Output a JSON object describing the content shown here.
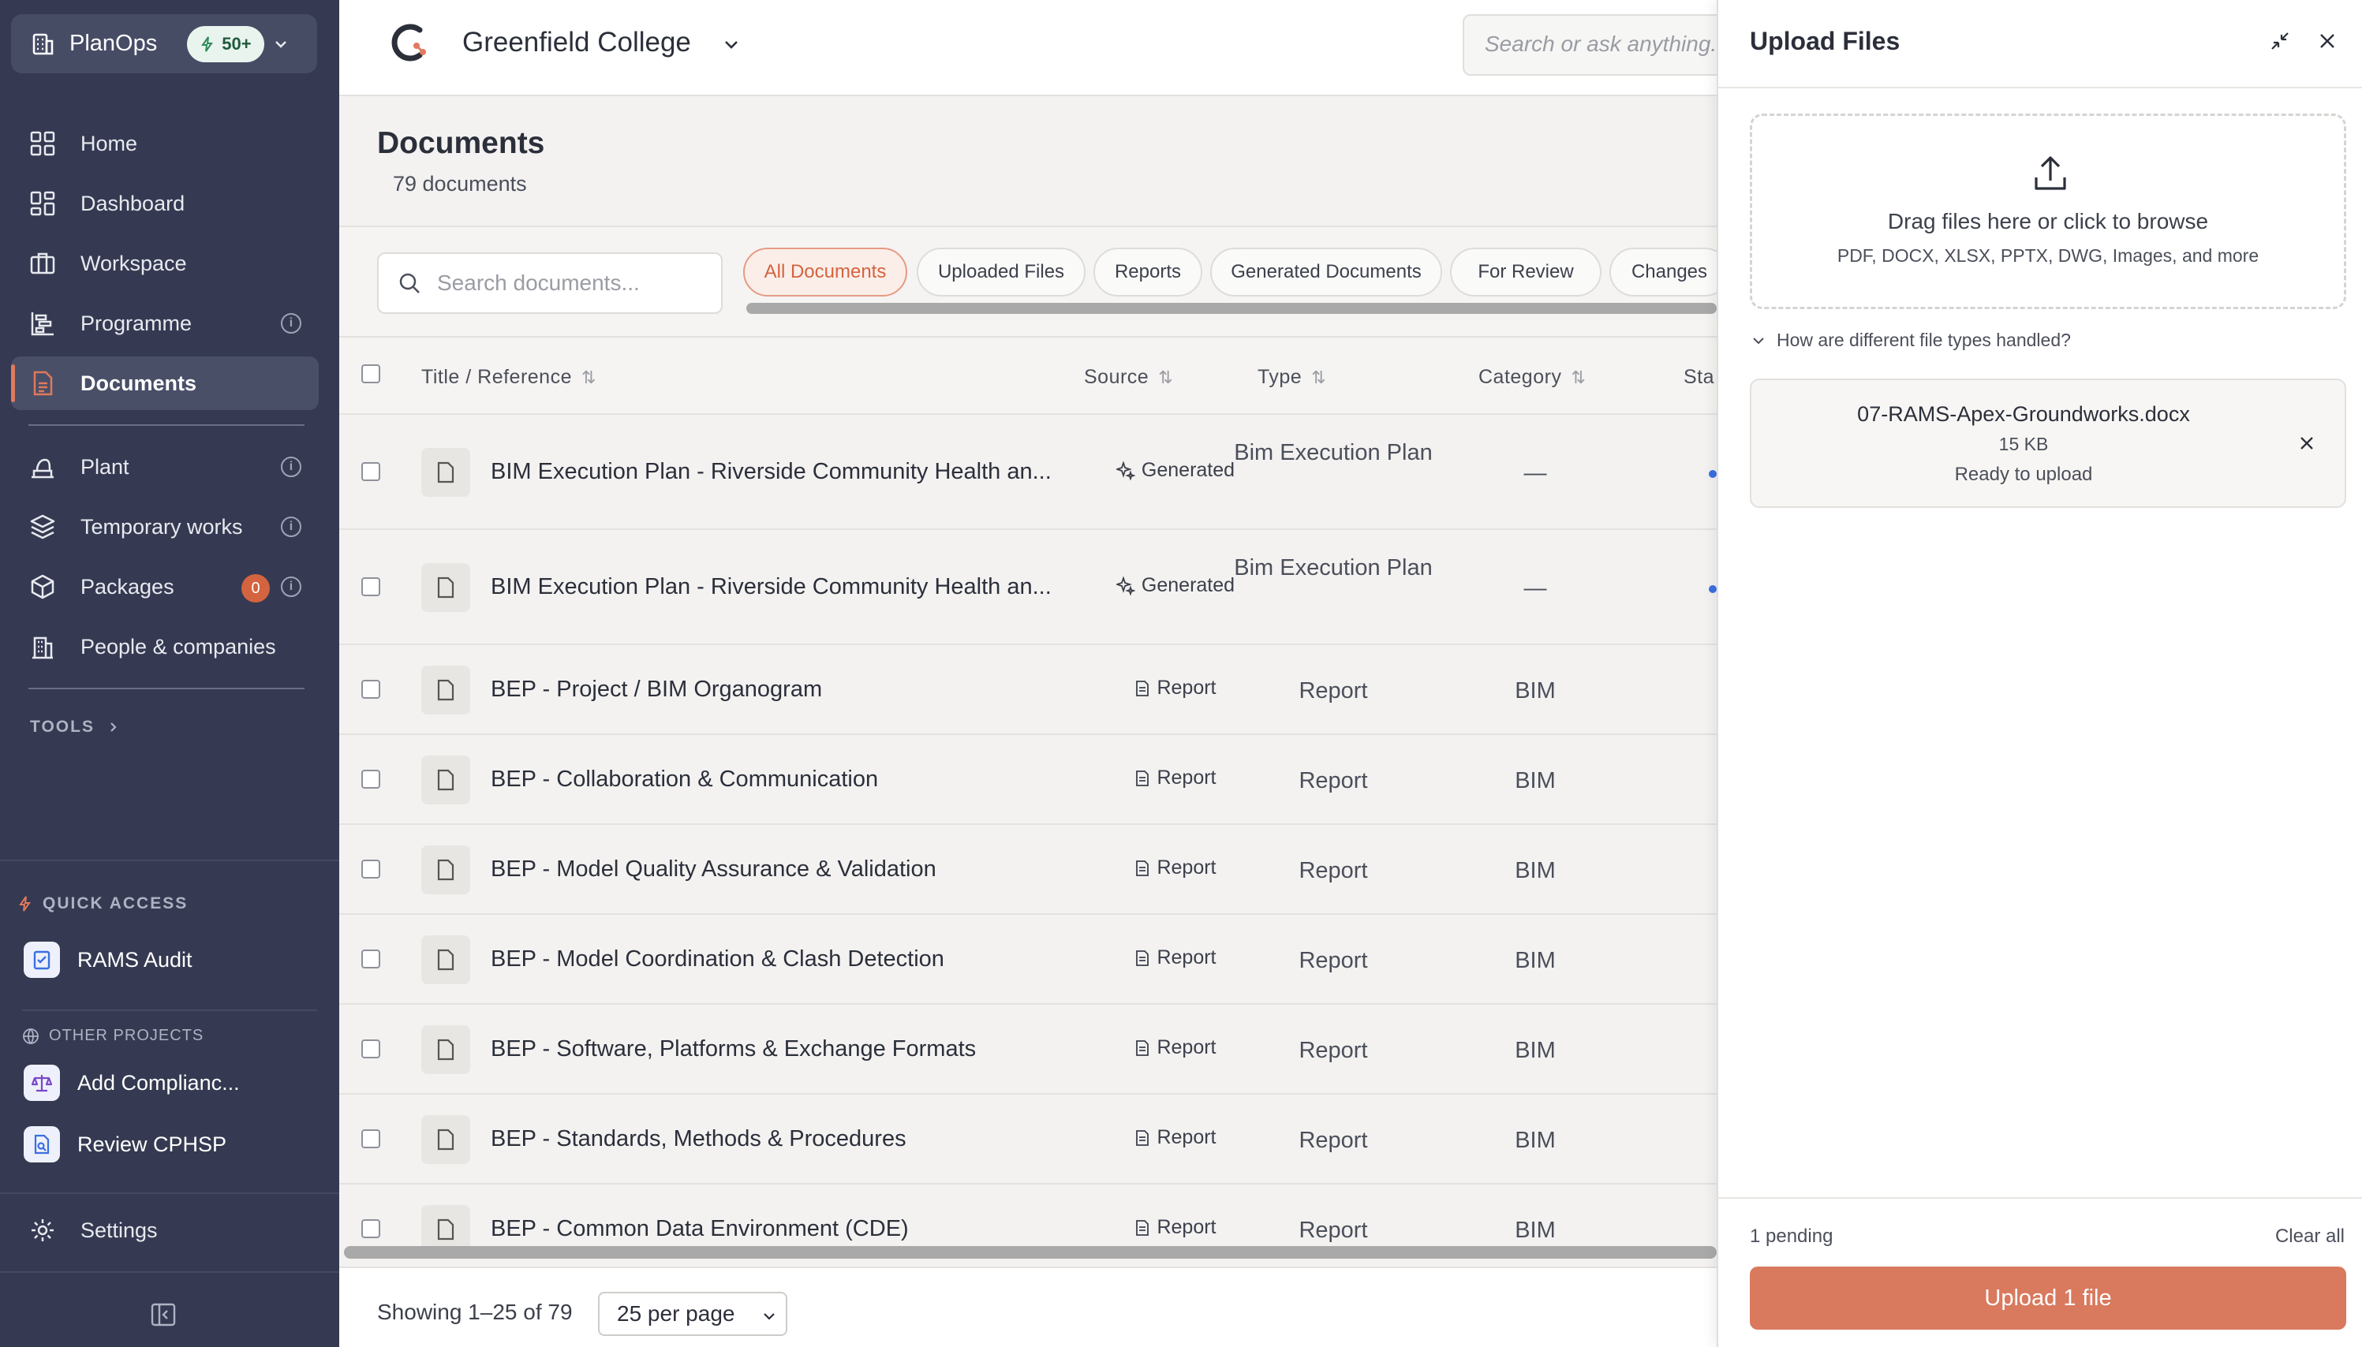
{
  "sidebar": {
    "app_name": "PlanOps",
    "badge": "50+",
    "nav": [
      {
        "label": "Home",
        "icon": "grid-icon"
      },
      {
        "label": "Dashboard",
        "icon": "dashboard-icon"
      },
      {
        "label": "Workspace",
        "icon": "briefcase-icon"
      },
      {
        "label": "Programme",
        "icon": "gantt-icon"
      },
      {
        "label": "Documents",
        "icon": "document-icon",
        "active": true
      },
      {
        "label": "Plant",
        "icon": "plant-icon"
      },
      {
        "label": "Temporary works",
        "icon": "layers-icon"
      },
      {
        "label": "Packages",
        "icon": "package-icon",
        "badge": "0"
      },
      {
        "label": "People & companies",
        "icon": "building-icon"
      }
    ],
    "tools_label": "TOOLS",
    "quick_access_label": "QUICK ACCESS",
    "quick_access": [
      {
        "label": "RAMS Audit"
      }
    ],
    "other_projects_label": "OTHER PROJECTS",
    "other_projects": [
      {
        "label": "Add Complianc..."
      },
      {
        "label": "Review CPHSP"
      }
    ],
    "settings_label": "Settings"
  },
  "topbar": {
    "project": "Greenfield College",
    "search_placeholder": "Search or ask anything..."
  },
  "documents": {
    "title": "Documents",
    "count": "79 documents",
    "search_placeholder": "Search documents...",
    "filters": [
      "All Documents",
      "Uploaded Files",
      "Reports",
      "Generated Documents",
      "For Review",
      "Changes"
    ],
    "active_filter": "All Documents",
    "columns": [
      "Title / Reference",
      "Source",
      "Type",
      "Category",
      "Sta"
    ],
    "rows": [
      {
        "title": "BIM Execution Plan - Riverside Community Health an...",
        "source": "Generated",
        "type": "Bim Execution Plan",
        "category": "—"
      },
      {
        "title": "BIM Execution Plan - Riverside Community Health an...",
        "source": "Generated",
        "type": "Bim Execution Plan",
        "category": "—"
      },
      {
        "title": "BEP - Project / BIM Organogram",
        "source": "Report",
        "type": "Report",
        "category": "BIM"
      },
      {
        "title": "BEP - Collaboration & Communication",
        "source": "Report",
        "type": "Report",
        "category": "BIM"
      },
      {
        "title": "BEP - Model Quality Assurance & Validation",
        "source": "Report",
        "type": "Report",
        "category": "BIM"
      },
      {
        "title": "BEP - Model Coordination & Clash Detection",
        "source": "Report",
        "type": "Report",
        "category": "BIM"
      },
      {
        "title": "BEP - Software, Platforms & Exchange Formats",
        "source": "Report",
        "type": "Report",
        "category": "BIM"
      },
      {
        "title": "BEP - Standards, Methods & Procedures",
        "source": "Report",
        "type": "Report",
        "category": "BIM"
      },
      {
        "title": "BEP - Common Data Environment (CDE)",
        "source": "Report",
        "type": "Report",
        "category": "BIM"
      }
    ],
    "showing": "Showing 1–25 of 79",
    "per_page": "25 per page"
  },
  "upload_panel": {
    "title": "Upload Files",
    "drop_main": "Drag files here or click to browse",
    "drop_sub": "PDF, DOCX, XLSX, PPTX, DWG, Images, and more",
    "faq": "How are different file types handled?",
    "file": {
      "name": "07-RAMS-Apex-Groundworks.docx",
      "size": "15 KB",
      "status": "Ready to upload"
    },
    "pending": "1 pending",
    "clear_all": "Clear all",
    "upload_button": "Upload 1 file"
  },
  "colors": {
    "sidebar": "#353a52",
    "accent": "#d9795e",
    "active_chip": "#d4633f"
  }
}
